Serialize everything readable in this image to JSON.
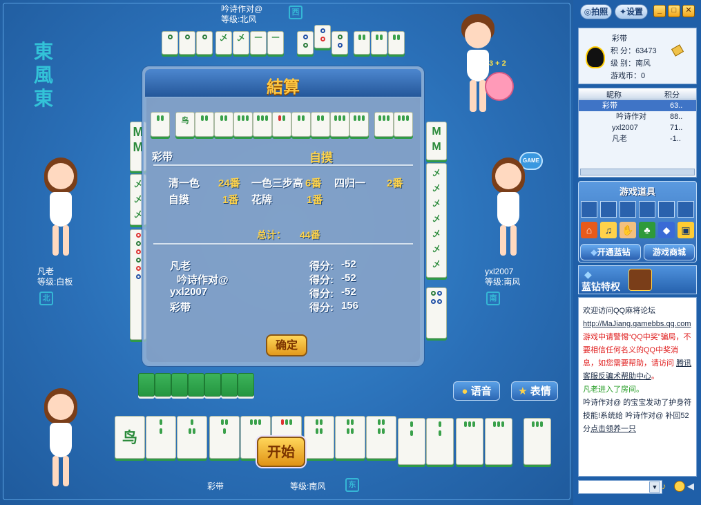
{
  "colors": {
    "table": "#2a6fb7",
    "accent_gold": "#ffd34a",
    "tile_green": "#3aa14b",
    "panel": "#1f5fa8"
  },
  "wind": [
    "東",
    "風",
    "東"
  ],
  "players": {
    "top": {
      "name": "吟诗作对@",
      "level": "等级:北风",
      "seat": "西"
    },
    "left": {
      "name": "凡老",
      "level": "等级:白板",
      "seat": "北"
    },
    "right": {
      "name": "yxl2007",
      "level": "等级:南风",
      "seat": "南"
    },
    "bottom": {
      "name": "彩带",
      "level": "等级:南风",
      "seat": "东"
    }
  },
  "top_badge": "3 + 2",
  "game_badge": "GAME",
  "dialog": {
    "title": "結算",
    "winner": "彩带",
    "win_type": "自摸",
    "fans": [
      {
        "name": "清一色",
        "value": "24番"
      },
      {
        "name": "一色三步高",
        "value": "6番"
      },
      {
        "name": "四归一",
        "value": "2番"
      },
      {
        "name": "自摸",
        "value": "1番"
      },
      {
        "name": "花牌",
        "value": "1番"
      }
    ],
    "total_label": "总计：",
    "total_value": "44番",
    "scores": [
      {
        "name": "凡老",
        "label": "得分:",
        "value": "-52"
      },
      {
        "name": "吟诗作对@",
        "label": "得分:",
        "value": "-52"
      },
      {
        "name": "yxl2007",
        "label": "得分:",
        "value": "-52"
      },
      {
        "name": "彩带",
        "label": "得分:",
        "value": "156"
      }
    ],
    "confirm": "确定"
  },
  "buttons": {
    "start": "开始",
    "voice": "语音",
    "emote": "表情"
  },
  "panel": {
    "photo": "拍照",
    "settings": "设置",
    "user": {
      "name": "彩带",
      "score_label": "积  分：",
      "score": "63473",
      "level_label": "级  别：",
      "level": "南风",
      "coins_label": "游戏币：",
      "coins": "0"
    },
    "list_headers": {
      "nick": "昵称",
      "score": "积分"
    },
    "list": [
      {
        "name": "彩带",
        "score": "63.."
      },
      {
        "name": "吟诗作对",
        "score": "88.."
      },
      {
        "name": "yxl2007",
        "score": "71.."
      },
      {
        "name": "凡老",
        "score": "-1.."
      }
    ],
    "tools_title": "游戏道具",
    "blue_diamond_btn": "开通蓝钻",
    "shop_btn": "游戏商城",
    "privilege": "蓝钻特权",
    "chat": {
      "l1": "欢迎访问QQ麻将论坛 ",
      "l1_link": "http://MaJiang.gamebbs.qq.com",
      "l2": "游戏中请警惕“QQ中奖”骗局，不要相信任何名义的QQ中奖消息，如您需要帮助，请访问 ",
      "l2_link": "腾讯客服反骗术帮助中心",
      "l2_end": "。",
      "l3": "凡老进入了房间。",
      "l4": " 吟诗作对@ 的宝宝发动了护身符技能!系统给 吟诗作对@ 补回52分",
      "l4_link": "点击领养一只"
    }
  }
}
